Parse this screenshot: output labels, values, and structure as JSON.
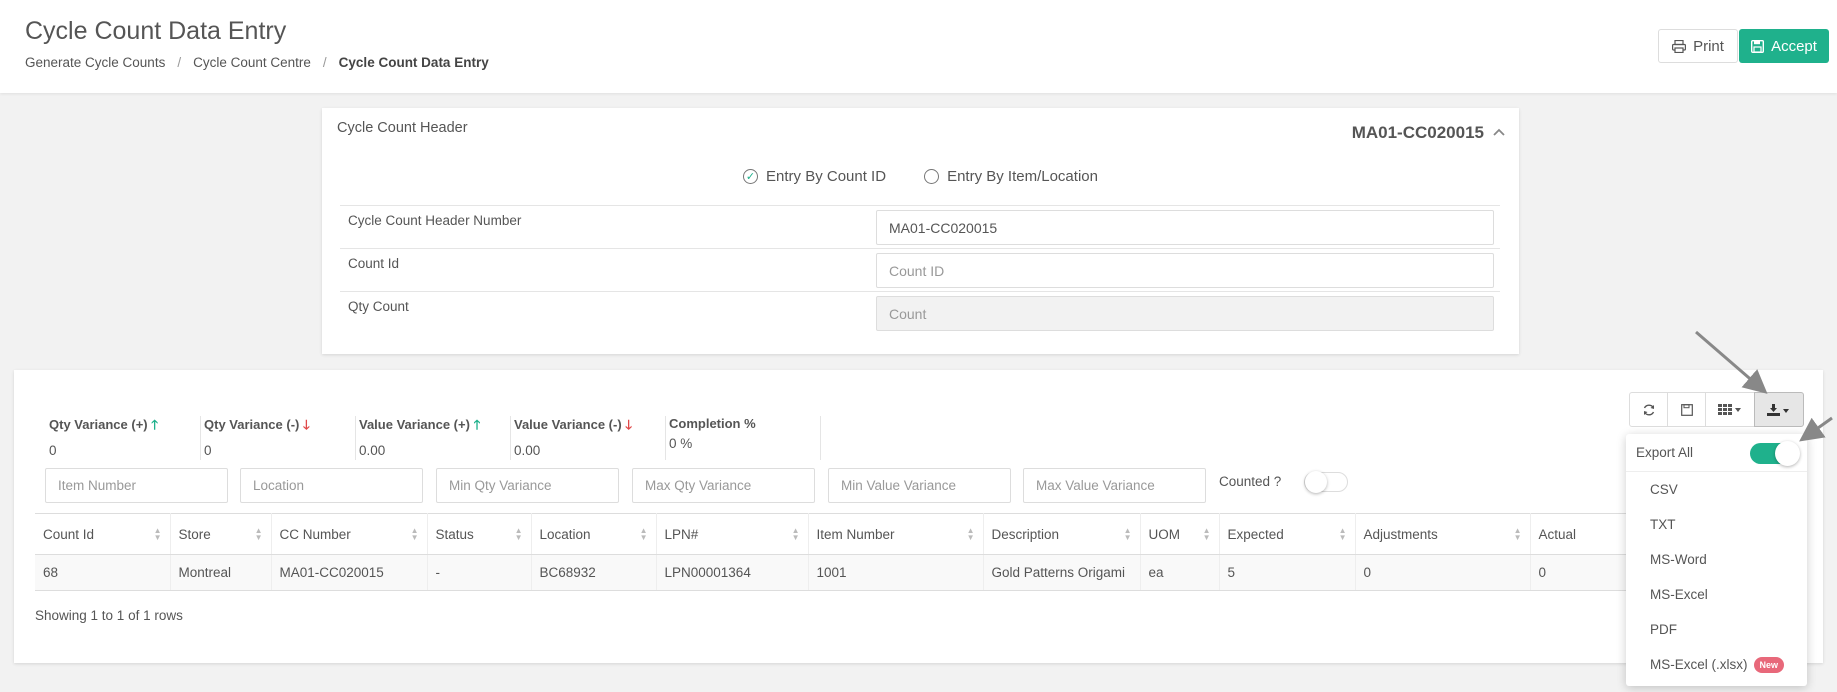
{
  "header": {
    "title": "Cycle Count Data Entry",
    "breadcrumb": [
      "Generate Cycle Counts",
      "Cycle Count Centre",
      "Cycle Count Data Entry"
    ],
    "print_label": "Print",
    "accept_label": "Accept"
  },
  "cc_header": {
    "title": "Cycle Count Header",
    "number": "MA01-CC020015",
    "radio_count_id": "Entry By Count ID",
    "radio_item_location": "Entry By Item/Location",
    "fields": {
      "header_number_label": "Cycle Count Header Number",
      "header_number_value": "MA01-CC020015",
      "count_id_label": "Count Id",
      "count_id_placeholder": "Count ID",
      "qty_count_label": "Qty Count",
      "qty_count_placeholder": "Count"
    }
  },
  "stats": [
    {
      "label": "Qty Variance (+)",
      "value": "0",
      "dir": "up"
    },
    {
      "label": "Qty Variance (-)",
      "value": "0",
      "dir": "down"
    },
    {
      "label": "Value Variance (+)",
      "value": "0.00",
      "dir": "up"
    },
    {
      "label": "Value Variance (-)",
      "value": "0.00",
      "dir": "down"
    },
    {
      "label": "Completion %",
      "value": "0 %",
      "dir": ""
    }
  ],
  "filters": {
    "item_number": "Item Number",
    "location": "Location",
    "min_qty": "Min Qty Variance",
    "max_qty": "Max Qty Variance",
    "min_value": "Min Value Variance",
    "max_value": "Max Value Variance",
    "counted_label": "Counted ?"
  },
  "table": {
    "columns": [
      "Count Id",
      "Store",
      "CC Number",
      "Status",
      "Location",
      "LPN#",
      "Item Number",
      "Description",
      "UOM",
      "Expected",
      "Adjustments",
      "Actual"
    ],
    "rows": [
      [
        "68",
        "Montreal",
        "MA01-CC020015",
        "-",
        "BC68932",
        "LPN00001364",
        "1001",
        "Gold Patterns Origami",
        "ea",
        "5",
        "0",
        "0"
      ]
    ],
    "footer": "Showing 1 to 1 of 1 rows"
  },
  "export_menu": {
    "export_all_label": "Export All",
    "items": [
      "CSV",
      "TXT",
      "MS-Word",
      "MS-Excel",
      "PDF",
      "MS-Excel (.xlsx)"
    ],
    "new_badge": "New"
  },
  "colors": {
    "accent": "#1fb18c",
    "down": "#e04848",
    "badge": "#e8687a"
  }
}
